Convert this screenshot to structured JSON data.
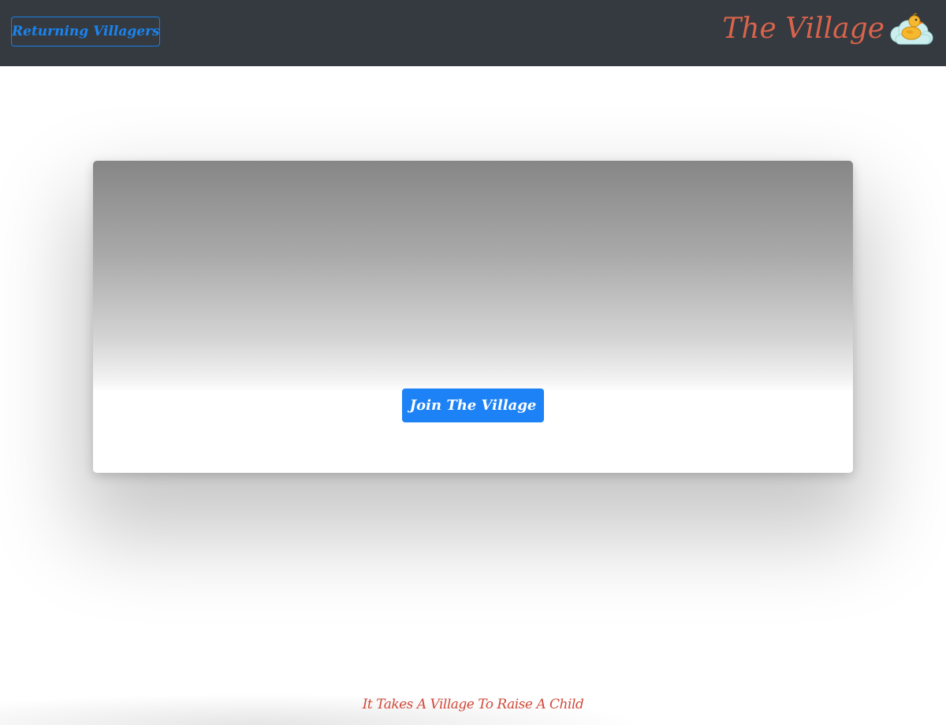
{
  "header": {
    "returning_button_label": "Returning Villagers",
    "brand_name": "The Village",
    "logo_icon": "rubber-duck-cloud-icon"
  },
  "hero": {
    "join_button_label": "Join The Village"
  },
  "footer": {
    "tagline": "It Takes A Village To Raise A Child"
  },
  "colors": {
    "navbar_bg": "#343a40",
    "primary_blue": "#1d82f5",
    "brand_red": "#d9634b",
    "duck_yellow": "#f5b82e",
    "cloud_teal": "#c9ecec"
  }
}
